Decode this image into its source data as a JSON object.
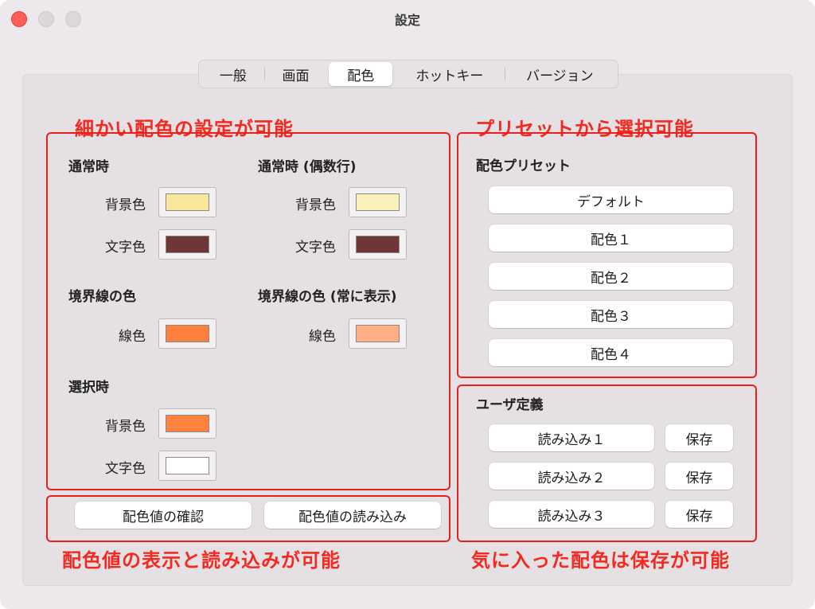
{
  "window": {
    "title": "設定"
  },
  "tabs": [
    {
      "label": "一般"
    },
    {
      "label": "画面"
    },
    {
      "label": "配色"
    },
    {
      "label": "ホットキー"
    },
    {
      "label": "バージョン"
    }
  ],
  "active_tab": "配色",
  "annotations": {
    "fine_color": "細かい配色の設定が可能",
    "preset": "プリセットから選択可能",
    "value_io": "配色値の表示と読み込みが可能",
    "save": "気に入った配色は保存が可能"
  },
  "colors": {
    "normal": {
      "title": "通常時",
      "bg_label": "背景色",
      "bg": "#f8e79a",
      "text_label": "文字色",
      "text": "#6e3636"
    },
    "normal_even": {
      "title": "通常時 (偶数行)",
      "bg_label": "背景色",
      "bg": "#fbf1bd",
      "text_label": "文字色",
      "text": "#6e3636"
    },
    "border": {
      "title": "境界線の色",
      "line_label": "線色",
      "line": "#ff7f3c"
    },
    "border_always": {
      "title": "境界線の色 (常に表示)",
      "line_label": "線色",
      "line": "#ffae85"
    },
    "selected": {
      "title": "選択時",
      "bg_label": "背景色",
      "bg": "#ff823f",
      "text_label": "文字色",
      "text": "#ffffff"
    }
  },
  "value_buttons": {
    "confirm": "配色値の確認",
    "load": "配色値の読み込み"
  },
  "presets": {
    "title": "配色プリセット",
    "items": [
      "デフォルト",
      "配色１",
      "配色２",
      "配色３",
      "配色４"
    ]
  },
  "user_defined": {
    "title": "ユーザ定義",
    "load_items": [
      "読み込み１",
      "読み込み２",
      "読み込み３"
    ],
    "save_label": "保存"
  }
}
